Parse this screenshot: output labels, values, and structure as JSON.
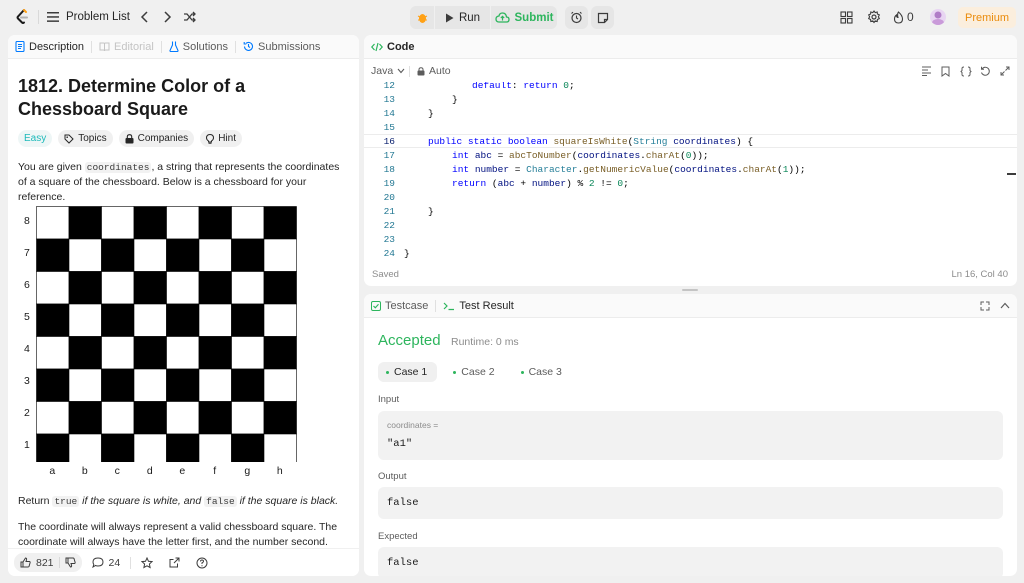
{
  "topbar": {
    "problem_list": "Problem List",
    "run": "Run",
    "submit": "Submit",
    "streak_count": "0",
    "premium": "Premium"
  },
  "left_tabs": {
    "description": "Description",
    "editorial": "Editorial",
    "solutions": "Solutions",
    "submissions": "Submissions"
  },
  "problem": {
    "title": "1812. Determine Color of a Chessboard Square",
    "difficulty": "Easy",
    "topics": "Topics",
    "companies": "Companies",
    "hint": "Hint",
    "p1_a": "You are given ",
    "p1_code": "coordinates",
    "p1_b": ", a string that represents the coordinates of a square of the chessboard. Below is a chessboard for your reference.",
    "ranks": [
      "8",
      "7",
      "6",
      "5",
      "4",
      "3",
      "2",
      "1"
    ],
    "files": [
      "a",
      "b",
      "c",
      "d",
      "e",
      "f",
      "g",
      "h"
    ],
    "p2_a": "Return ",
    "p2_code1": "true",
    "p2_b": " if the square is white, and ",
    "p2_code2": "false",
    "p2_c": " if the square is black.",
    "p3": "The coordinate will always represent a valid chessboard square. The coordinate will always have the letter first, and the number second."
  },
  "footer": {
    "likes": "821",
    "comments": "24"
  },
  "code_panel": {
    "tab": "Code",
    "language": "Java",
    "mode": "Auto",
    "status_saved": "Saved",
    "cursor": "Ln 16, Col 40",
    "line_numbers": [
      "12",
      "13",
      "14",
      "15",
      "16",
      "17",
      "18",
      "19",
      "20",
      "21",
      "22",
      "23",
      "24"
    ]
  },
  "result_panel": {
    "testcase_tab": "Testcase",
    "result_tab": "Test Result",
    "verdict": "Accepted",
    "runtime": "Runtime: 0 ms",
    "cases": [
      "Case 1",
      "Case 2",
      "Case 3"
    ],
    "input_label": "Input",
    "input_var": "coordinates =",
    "input_value": "\"a1\"",
    "output_label": "Output",
    "output_value": "false",
    "expected_label": "Expected",
    "expected_value": "false"
  },
  "colors": {
    "accent_green": "#2db55d",
    "easy_teal": "#1cbaba",
    "premium_orange": "#ea8b0b"
  }
}
